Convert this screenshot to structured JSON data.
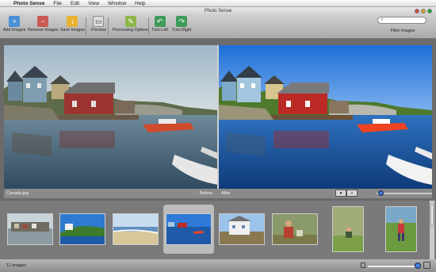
{
  "menubar": {
    "apple": "",
    "app_name": "Photo Sense",
    "items": [
      "File",
      "Edit",
      "View",
      "Window",
      "Help"
    ]
  },
  "window": {
    "title": "Photo Sense"
  },
  "toolbar": {
    "add_images": "Add Images",
    "remove_images": "Remove Images",
    "save_images": "Save Images",
    "preview": "Preview",
    "processing_options": "Processing Options",
    "turn_left": "Turn Left",
    "turn_right": "Turn Right",
    "filter_label": "Filter Images"
  },
  "preview": {
    "filename": "Canada.jpg",
    "before_label": "Before",
    "after_label": "After"
  },
  "status": {
    "count": "11 images"
  },
  "colors": {
    "accent": "#3d7fe0",
    "toolbar": "#b9b9b9",
    "strip": "#7a7a7a"
  }
}
